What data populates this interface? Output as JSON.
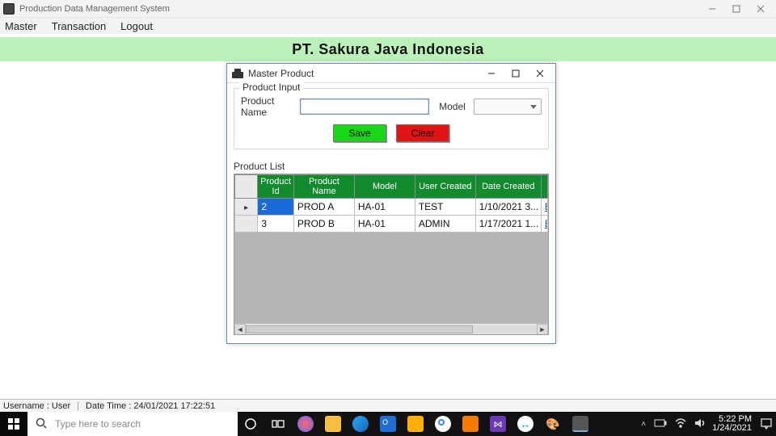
{
  "window": {
    "title": "Production Data Management System",
    "btn_min": "—",
    "btn_max": "▢",
    "btn_close": "✕"
  },
  "menubar": {
    "items": [
      "Master",
      "Transaction",
      "Logout"
    ]
  },
  "company_banner": "PT. Sakura Java Indonesia",
  "dialog": {
    "title": "Master Product",
    "input_group_title": "Product Input",
    "product_name_label": "Product Name",
    "product_name_value": "",
    "model_label": "Model",
    "model_value": "",
    "save_label": "Save",
    "clear_label": "Clear",
    "list_label": "Product List"
  },
  "grid": {
    "headers": [
      "Product Id",
      "Product Name",
      "Model",
      "User Created",
      "Date Created"
    ],
    "rows": [
      {
        "id": "2",
        "name": "PROD A",
        "model": "HA-01",
        "user": "TEST",
        "date": "1/10/2021 3..."
      },
      {
        "id": "3",
        "name": "PROD B",
        "model": "HA-01",
        "user": "ADMIN",
        "date": "1/17/2021 1..."
      }
    ]
  },
  "status": {
    "username_label": "Username :",
    "username_value": "User",
    "datetime_label": "Date Time :",
    "datetime_value": "24/01/2021 17:22:51"
  },
  "taskbar": {
    "search_placeholder": "Type here to search",
    "time": "5:22 PM",
    "date": "1/24/2021",
    "tray_up": "˄"
  }
}
